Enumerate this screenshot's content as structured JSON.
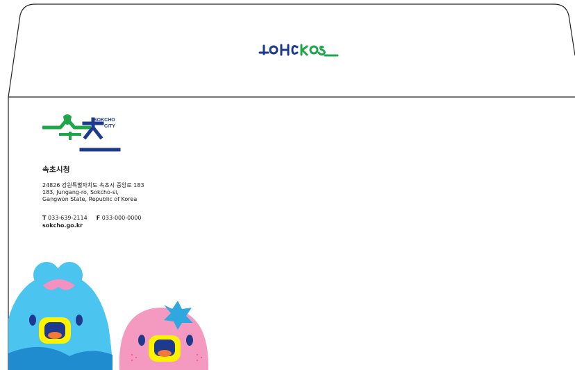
{
  "flap": {
    "wordmark": "sokcho"
  },
  "logo": {
    "sokcho": "SOKCHO",
    "city": "CITY",
    "colors": {
      "green": "#1fa64a",
      "navy": "#1d3a8f"
    }
  },
  "sender": {
    "org_name": "속초시청",
    "address_ko": "24826 강원특별자치도 속초시 중앙로 183",
    "address_en_1": "183, Jungang-ro, Sokcho-si,",
    "address_en_2": "Gangwon State, Republic of Korea",
    "tel_label": "T",
    "tel": "033-639-2114",
    "fax_label": "F",
    "fax": "033-000-0000",
    "website": "sokcho.go.kr"
  },
  "mascots": [
    {
      "name": "blue-mascot",
      "color": "#4bc4ef"
    },
    {
      "name": "pink-mascot",
      "color": "#f49ac1"
    }
  ]
}
